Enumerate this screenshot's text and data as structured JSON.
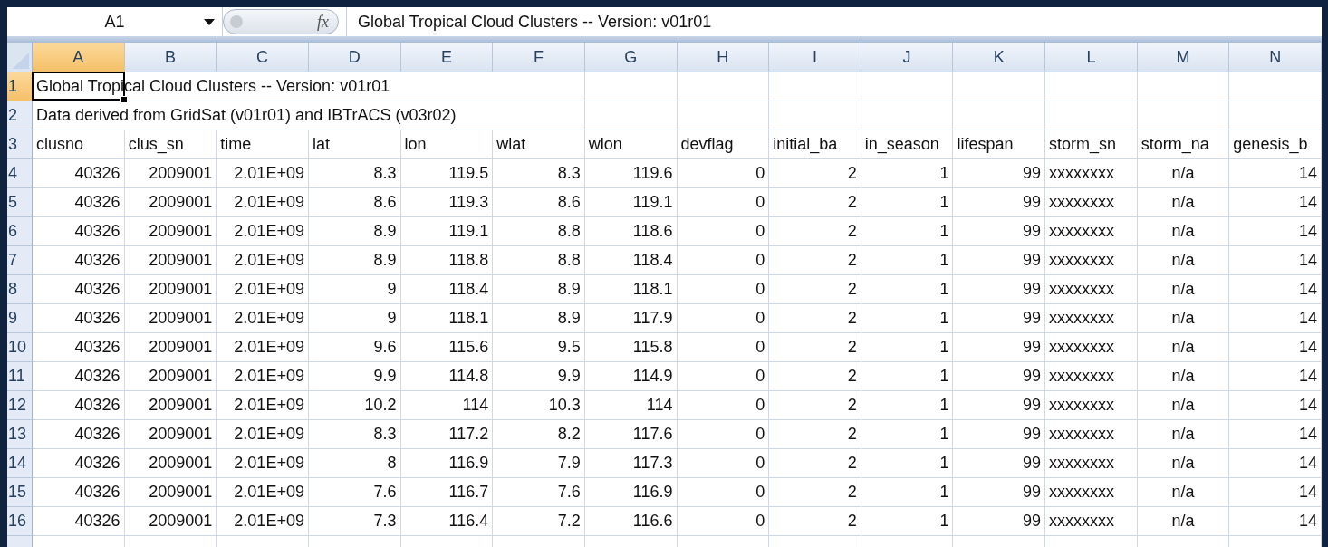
{
  "formula_bar": {
    "name_box": "A1",
    "function_label": "fx",
    "formula": "Global Tropical Cloud Clusters -- Version: v01r01"
  },
  "columns": [
    {
      "letter": "A",
      "selected": true
    },
    {
      "letter": "B",
      "selected": false
    },
    {
      "letter": "C",
      "selected": false
    },
    {
      "letter": "D",
      "selected": false
    },
    {
      "letter": "E",
      "selected": false
    },
    {
      "letter": "F",
      "selected": false
    },
    {
      "letter": "G",
      "selected": false
    },
    {
      "letter": "H",
      "selected": false
    },
    {
      "letter": "I",
      "selected": false
    },
    {
      "letter": "J",
      "selected": false
    },
    {
      "letter": "K",
      "selected": false
    },
    {
      "letter": "L",
      "selected": false
    },
    {
      "letter": "M",
      "selected": false
    },
    {
      "letter": "N",
      "selected": false
    }
  ],
  "rows": [
    {
      "number": "1",
      "selected": true,
      "kind": "span",
      "text": "Global Tropical Cloud Clusters -- Version: v01r01"
    },
    {
      "number": "2",
      "selected": false,
      "kind": "span",
      "text": "Data derived from GridSat (v01r01) and IBTrACS (v03r02)"
    },
    {
      "number": "3",
      "selected": false,
      "kind": "header",
      "cells": [
        "clusno",
        "clus_sn",
        "time",
        "lat",
        "lon",
        "wlat",
        "wlon",
        "devflag",
        "initial_ba",
        "in_season",
        "lifespan",
        "storm_sn",
        "storm_na",
        "genesis_b"
      ]
    },
    {
      "number": "4",
      "selected": false,
      "kind": "data",
      "cells": [
        "40326",
        "2009001",
        "2.01E+09",
        "8.3",
        "119.5",
        "8.3",
        "119.6",
        "0",
        "2",
        "1",
        "99",
        "xxxxxxxx",
        "n/a",
        "14"
      ]
    },
    {
      "number": "5",
      "selected": false,
      "kind": "data",
      "cells": [
        "40326",
        "2009001",
        "2.01E+09",
        "8.6",
        "119.3",
        "8.6",
        "119.1",
        "0",
        "2",
        "1",
        "99",
        "xxxxxxxx",
        "n/a",
        "14"
      ]
    },
    {
      "number": "6",
      "selected": false,
      "kind": "data",
      "cells": [
        "40326",
        "2009001",
        "2.01E+09",
        "8.9",
        "119.1",
        "8.8",
        "118.6",
        "0",
        "2",
        "1",
        "99",
        "xxxxxxxx",
        "n/a",
        "14"
      ]
    },
    {
      "number": "7",
      "selected": false,
      "kind": "data",
      "cells": [
        "40326",
        "2009001",
        "2.01E+09",
        "8.9",
        "118.8",
        "8.8",
        "118.4",
        "0",
        "2",
        "1",
        "99",
        "xxxxxxxx",
        "n/a",
        "14"
      ]
    },
    {
      "number": "8",
      "selected": false,
      "kind": "data",
      "cells": [
        "40326",
        "2009001",
        "2.01E+09",
        "9",
        "118.4",
        "8.9",
        "118.1",
        "0",
        "2",
        "1",
        "99",
        "xxxxxxxx",
        "n/a",
        "14"
      ]
    },
    {
      "number": "9",
      "selected": false,
      "kind": "data",
      "cells": [
        "40326",
        "2009001",
        "2.01E+09",
        "9",
        "118.1",
        "8.9",
        "117.9",
        "0",
        "2",
        "1",
        "99",
        "xxxxxxxx",
        "n/a",
        "14"
      ]
    },
    {
      "number": "10",
      "selected": false,
      "kind": "data",
      "cells": [
        "40326",
        "2009001",
        "2.01E+09",
        "9.6",
        "115.6",
        "9.5",
        "115.8",
        "0",
        "2",
        "1",
        "99",
        "xxxxxxxx",
        "n/a",
        "14"
      ]
    },
    {
      "number": "11",
      "selected": false,
      "kind": "data",
      "cells": [
        "40326",
        "2009001",
        "2.01E+09",
        "9.9",
        "114.8",
        "9.9",
        "114.9",
        "0",
        "2",
        "1",
        "99",
        "xxxxxxxx",
        "n/a",
        "14"
      ]
    },
    {
      "number": "12",
      "selected": false,
      "kind": "data",
      "cells": [
        "40326",
        "2009001",
        "2.01E+09",
        "10.2",
        "114",
        "10.3",
        "114",
        "0",
        "2",
        "1",
        "99",
        "xxxxxxxx",
        "n/a",
        "14"
      ]
    },
    {
      "number": "13",
      "selected": false,
      "kind": "data",
      "cells": [
        "40326",
        "2009001",
        "2.01E+09",
        "8.3",
        "117.2",
        "8.2",
        "117.6",
        "0",
        "2",
        "1",
        "99",
        "xxxxxxxx",
        "n/a",
        "14"
      ]
    },
    {
      "number": "14",
      "selected": false,
      "kind": "data",
      "cells": [
        "40326",
        "2009001",
        "2.01E+09",
        "8",
        "116.9",
        "7.9",
        "117.3",
        "0",
        "2",
        "1",
        "99",
        "xxxxxxxx",
        "n/a",
        "14"
      ]
    },
    {
      "number": "15",
      "selected": false,
      "kind": "data",
      "cells": [
        "40326",
        "2009001",
        "2.01E+09",
        "7.6",
        "116.7",
        "7.6",
        "116.9",
        "0",
        "2",
        "1",
        "99",
        "xxxxxxxx",
        "n/a",
        "14"
      ]
    },
    {
      "number": "16",
      "selected": false,
      "kind": "data",
      "cells": [
        "40326",
        "2009001",
        "2.01E+09",
        "7.3",
        "116.4",
        "7.2",
        "116.6",
        "0",
        "2",
        "1",
        "99",
        "xxxxxxxx",
        "n/a",
        "14"
      ]
    }
  ]
}
